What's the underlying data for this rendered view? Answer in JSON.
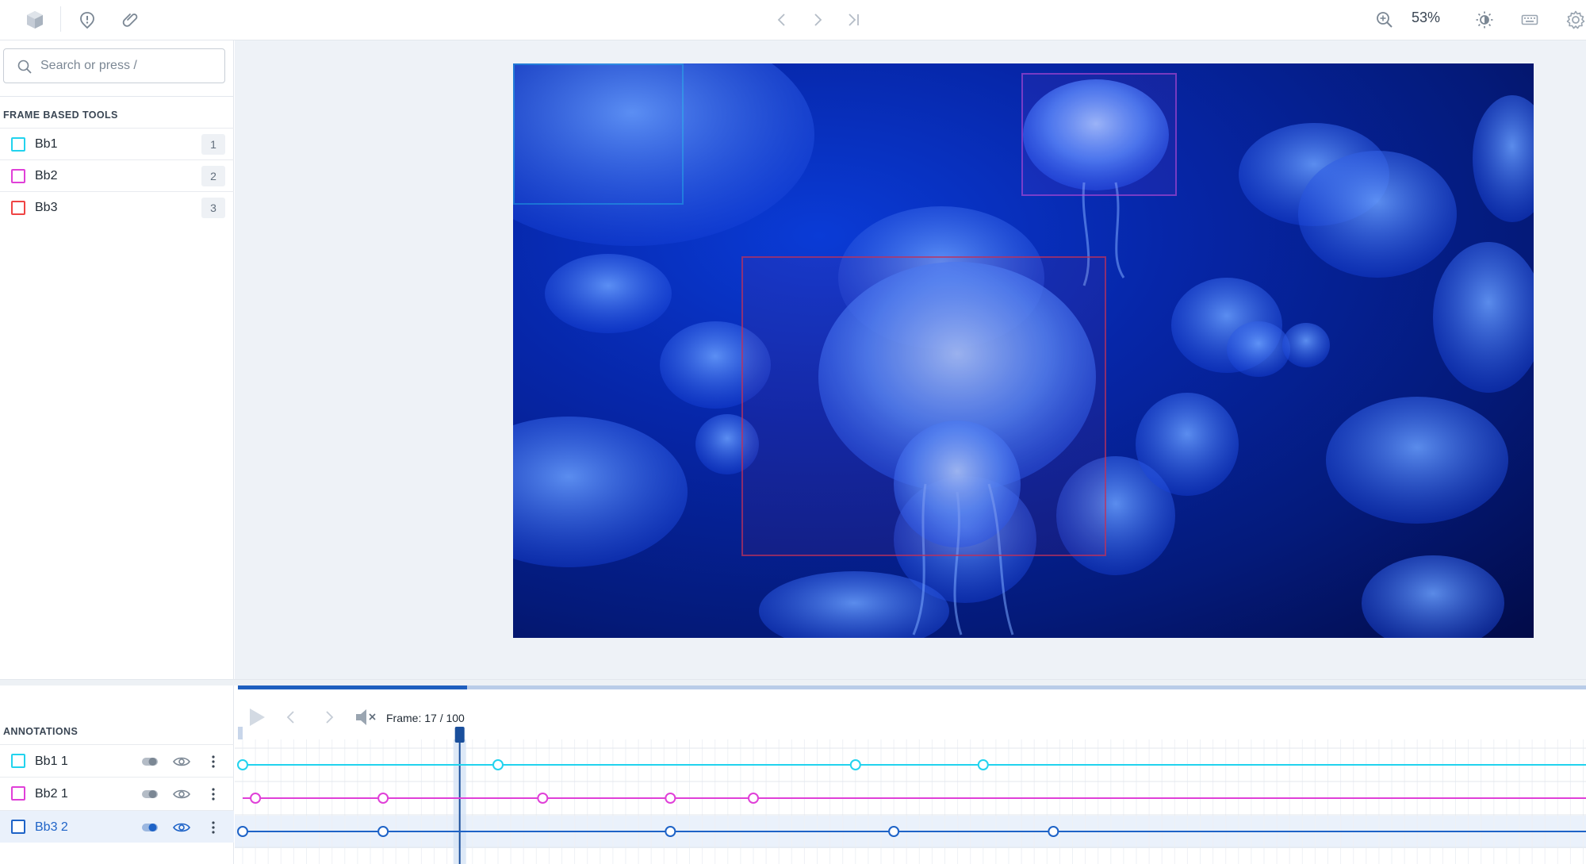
{
  "toolbar": {
    "logo_icon": "cube-logo-icon",
    "left_icons": [
      "issue-icon",
      "attachment-icon"
    ],
    "nav_icons": [
      "chevron-left-icon",
      "chevron-right-icon",
      "skip-to-end-icon"
    ],
    "zoom_level": "53%",
    "right_icons": [
      "zoom-in-icon",
      "brightness-icon",
      "keyboard-icon",
      "gear-icon"
    ]
  },
  "search": {
    "placeholder": "Search or press /"
  },
  "tools": {
    "title": "FRAME BASED TOOLS",
    "items": [
      {
        "label": "Bb1",
        "shortcut": "1",
        "color": "#22d3ee"
      },
      {
        "label": "Bb2",
        "shortcut": "2",
        "color": "#e040d8"
      },
      {
        "label": "Bb3",
        "shortcut": "3",
        "color": "#ef4444"
      }
    ]
  },
  "viewer": {
    "boxes": [
      {
        "tool": "Bb1",
        "color": "#22d3ee"
      },
      {
        "tool": "Bb2",
        "color": "#c84ad8"
      },
      {
        "tool": "Bb3",
        "color": "#c0305a"
      }
    ]
  },
  "annotations": {
    "title": "ANNOTATIONS",
    "items": [
      {
        "label": "Bb1 1",
        "color": "#22d3ee",
        "selected": false,
        "track_color": "#22d3ee",
        "keyframes": [
          0,
          20,
          48,
          58
        ]
      },
      {
        "label": "Bb2 1",
        "color": "#e040d8",
        "selected": false,
        "track_color": "#e040d8",
        "keyframes": [
          1,
          11,
          23.5,
          33.5,
          40
        ]
      },
      {
        "label": "Bb3 2",
        "color": "#1e63c7",
        "selected": true,
        "track_color": "#1e63c7",
        "keyframes": [
          0,
          11,
          33.5,
          51,
          63.5
        ]
      }
    ]
  },
  "player": {
    "frame_label": "Frame: 17 / 100",
    "current_frame": 17,
    "total_frames": 100,
    "progress_fraction": 0.17,
    "icons": [
      "play-icon",
      "prev-frame-icon",
      "next-frame-icon",
      "mute-icon"
    ]
  }
}
